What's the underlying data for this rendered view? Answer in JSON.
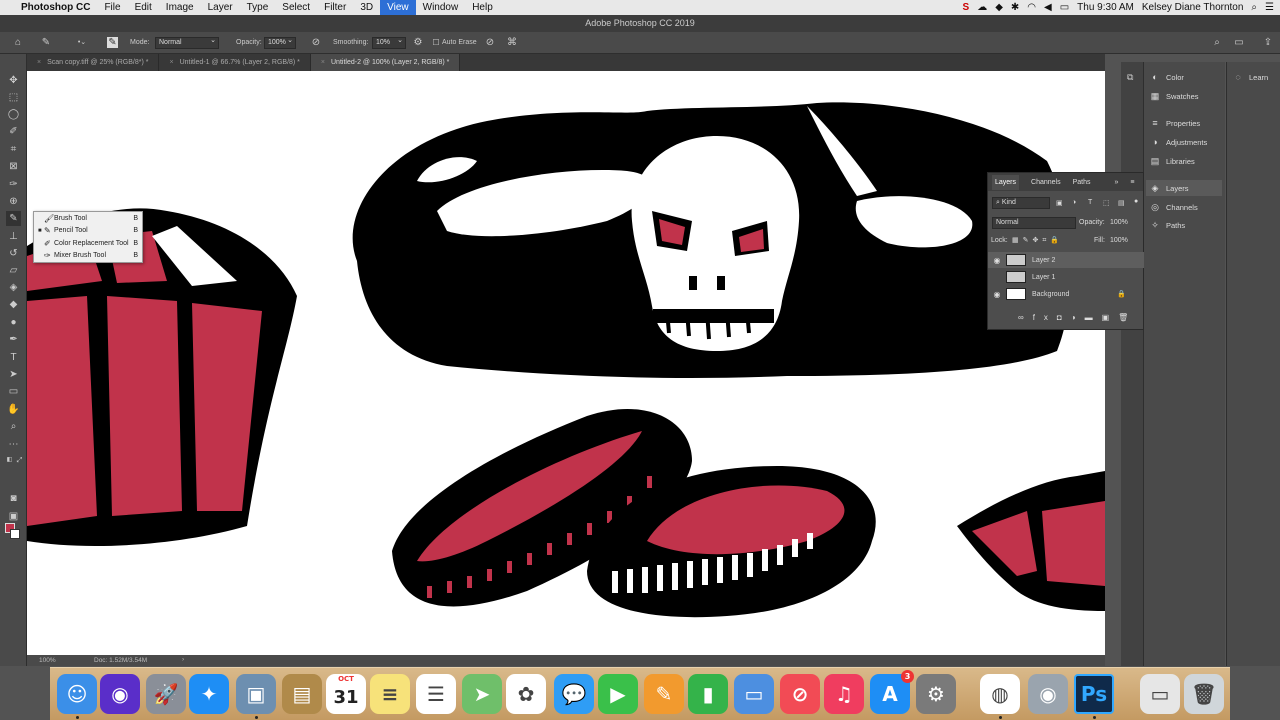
{
  "menubar": {
    "app": "Photoshop CC",
    "items": [
      "File",
      "Edit",
      "Image",
      "Layer",
      "Type",
      "Select",
      "Filter",
      "3D",
      "View",
      "Window",
      "Help"
    ],
    "active_item": "View",
    "clock": "Thu 9:30 AM",
    "user": "Kelsey Diane Thornton"
  },
  "window_title": "Adobe Photoshop CC 2019",
  "options": {
    "mode_label": "Mode:",
    "mode_value": "Normal",
    "opacity_label": "Opacity:",
    "opacity_value": "100%",
    "smoothing_label": "Smoothing:",
    "smoothing_value": "10%",
    "auto_erase_label": "Auto Erase"
  },
  "tabs": [
    {
      "label": "Scan copy.tiff @ 25% (RGB/8*) *",
      "active": false
    },
    {
      "label": "Untitled-1 @ 66.7% (Layer 2, RGB/8) *",
      "active": false
    },
    {
      "label": "Untitled-2 @ 100% (Layer 2, RGB/8) *",
      "active": true
    }
  ],
  "tool_flyout": [
    {
      "label": "Brush Tool",
      "key": "B",
      "icon": "brush-icon",
      "selected": false
    },
    {
      "label": "Pencil Tool",
      "key": "B",
      "icon": "pencil-icon",
      "selected": true
    },
    {
      "label": "Color Replacement Tool",
      "key": "B",
      "icon": "color-replace-icon",
      "selected": false
    },
    {
      "label": "Mixer Brush Tool",
      "key": "B",
      "icon": "mixer-brush-icon",
      "selected": false
    }
  ],
  "colors": {
    "foreground": "#c1334b",
    "background": "#ffffff",
    "accent": "#2d6fd6"
  },
  "status": {
    "zoom": "100%",
    "doc": "Doc: 1.52M/3.54M"
  },
  "right_dock": {
    "col1": [
      "Color",
      "Swatches",
      "Properties",
      "Adjustments",
      "Libraries",
      "Layers",
      "Channels",
      "Paths"
    ],
    "selected": "Layers",
    "col2": [
      "Learn"
    ]
  },
  "layers_panel": {
    "tabs": [
      "Layers",
      "Channels",
      "Paths"
    ],
    "filter_kind": "Kind",
    "blend_mode": "Normal",
    "opacity_label": "Opacity:",
    "opacity_value": "100%",
    "lock_label": "Lock:",
    "fill_label": "Fill:",
    "fill_value": "100%",
    "layers": [
      {
        "name": "Layer 2",
        "visible": true,
        "selected": true
      },
      {
        "name": "Layer 1",
        "visible": false,
        "selected": false
      },
      {
        "name": "Background",
        "visible": true,
        "selected": false,
        "locked": true
      }
    ]
  },
  "dock_apps": [
    "Finder",
    "Siri",
    "Launchpad",
    "Safari",
    "Preview",
    "Notes Folder",
    "Calendar",
    "Notes",
    "Reminders",
    "Maps",
    "Photos",
    "Messages",
    "FaceTime",
    "Pages",
    "Numbers",
    "Keynote",
    "News",
    "Music",
    "App Store",
    "System Preferences",
    "Chrome",
    "Image Capture",
    "Photoshop",
    "Documents",
    "Trash"
  ],
  "calendar": {
    "month": "OCT",
    "day": "31"
  },
  "app_store_badge": "3"
}
